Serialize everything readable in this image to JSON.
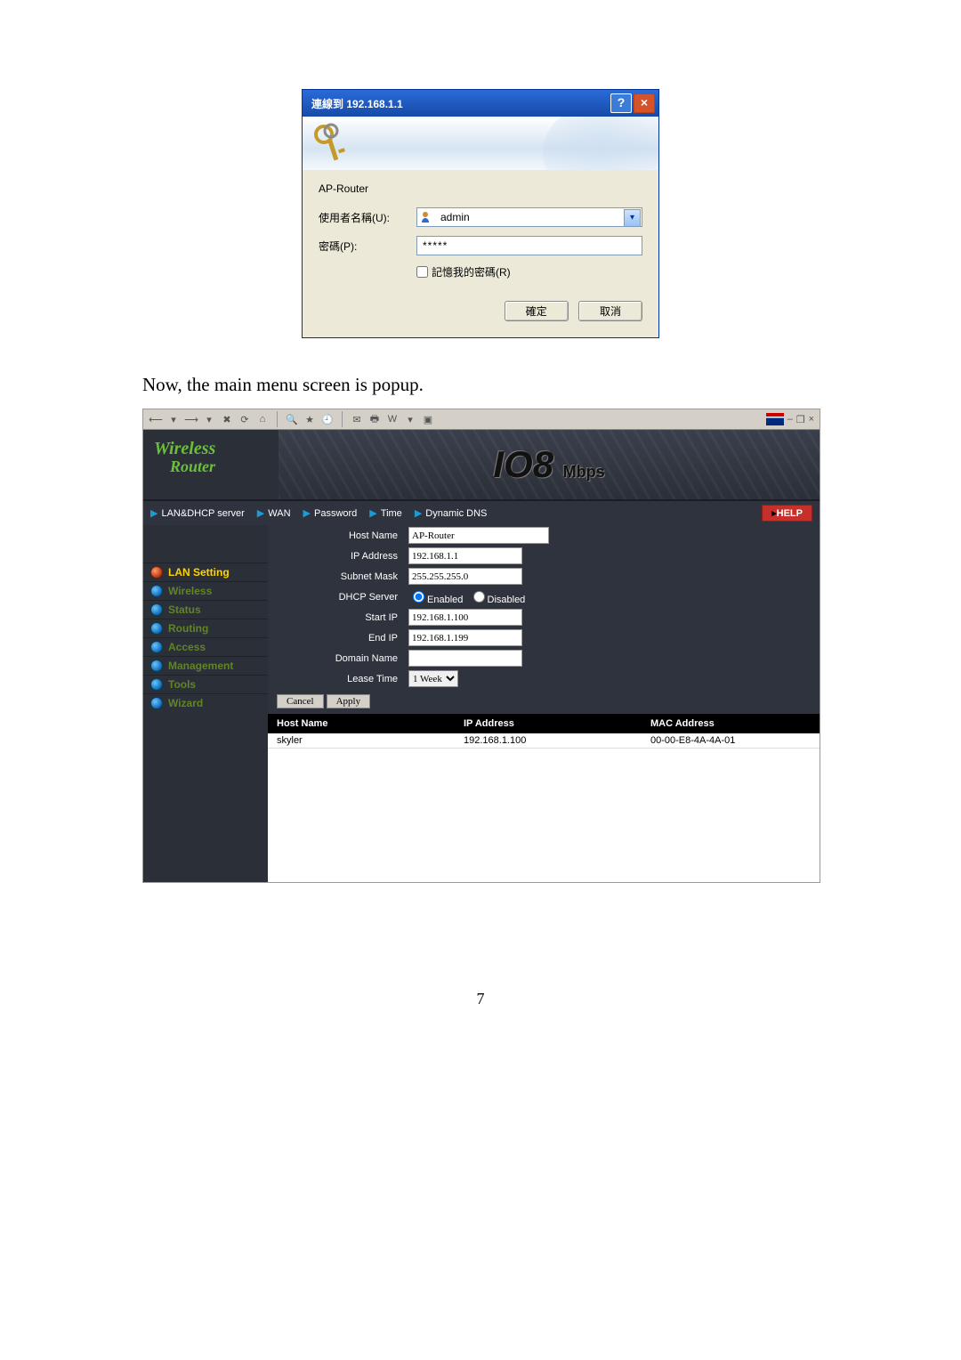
{
  "auth_dialog": {
    "title": "連線到 192.168.1.1",
    "realm": "AP-Router",
    "username_label": "使用者名稱(U):",
    "username_value": "admin",
    "password_label": "密碼(P):",
    "password_value": "*****",
    "remember_label": "記憶我的密碼(R)",
    "ok_label": "確定",
    "cancel_label": "取消"
  },
  "caption": "Now, the main menu screen is popup.",
  "router": {
    "logo_line1": "Wireless",
    "logo_line2": "Router",
    "speed_label": "108 Mbps",
    "crumbs": [
      "LAN&DHCP server",
      "WAN",
      "Password",
      "Time",
      "Dynamic DNS"
    ],
    "help_label": "HELP",
    "nav": [
      {
        "label": "LAN Setting",
        "active": true
      },
      {
        "label": "Wireless",
        "active": false
      },
      {
        "label": "Status",
        "active": false
      },
      {
        "label": "Routing",
        "active": false
      },
      {
        "label": "Access",
        "active": false
      },
      {
        "label": "Management",
        "active": false
      },
      {
        "label": "Tools",
        "active": false
      },
      {
        "label": "Wizard",
        "active": false
      }
    ],
    "form": {
      "host_name_label": "Host Name",
      "host_name": "AP-Router",
      "ip_label": "IP Address",
      "ip": "192.168.1.1",
      "subnet_label": "Subnet Mask",
      "subnet": "255.255.255.0",
      "dhcp_label": "DHCP Server",
      "dhcp_enabled": "Enabled",
      "dhcp_disabled": "Disabled",
      "start_ip_label": "Start IP",
      "start_ip": "192.168.1.100",
      "end_ip_label": "End IP",
      "end_ip": "192.168.1.199",
      "domain_label": "Domain Name",
      "domain": "",
      "lease_label": "Lease Time",
      "lease_value": "1 Week",
      "cancel_label": "Cancel",
      "apply_label": "Apply"
    },
    "table": {
      "headers": [
        "Host Name",
        "IP Address",
        "MAC Address"
      ],
      "row": {
        "host": "skyler",
        "ip": "192.168.1.100",
        "mac": "00-00-E8-4A-4A-01"
      }
    }
  },
  "page_number": "7"
}
